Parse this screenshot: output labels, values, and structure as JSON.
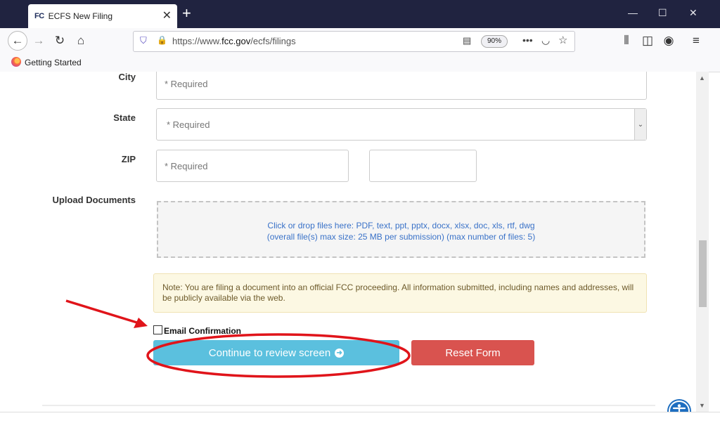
{
  "browser": {
    "tab_icon_text": "FC",
    "tab_title": "ECFS New Filing",
    "url_prefix": "https://www.",
    "url_domain": "fcc.gov",
    "url_path": "/ecfs/filings",
    "zoom": "90%",
    "bookmark": "Getting Started"
  },
  "form": {
    "city_label": "City",
    "city_placeholder": "* Required",
    "state_label": "State",
    "state_placeholder": "* Required",
    "zip_label": "ZIP",
    "zip_placeholder": "* Required",
    "upload_label": "Upload Documents",
    "dropzone_line1": "Click or drop files here: PDF, text, ppt, pptx, docx, xlsx, doc, xls, rtf, dwg",
    "dropzone_line2": "(overall file(s) max size: 25 MB per submission) (max number of files: 5)",
    "note": "Note: You are filing a document into an official FCC proceeding. All information submitted, including names and addresses, will be publicly available via the web.",
    "email_confirmation_label": "Email Confirmation",
    "continue_button": "Continue to review screen",
    "reset_button": "Reset Form"
  },
  "colors": {
    "continue": "#5bc0de",
    "reset": "#d9534f",
    "annotation": "#e0141a",
    "accessibility": "#1e6ec0"
  },
  "icons": [
    "back-arrow-icon",
    "forward-arrow-icon",
    "reload-icon",
    "home-icon",
    "shield-icon",
    "lock-icon",
    "reader-icon",
    "more-icon",
    "pocket-icon",
    "star-icon",
    "library-icon",
    "sidebar-icon",
    "account-icon",
    "menu-icon",
    "accessibility-icon"
  ]
}
